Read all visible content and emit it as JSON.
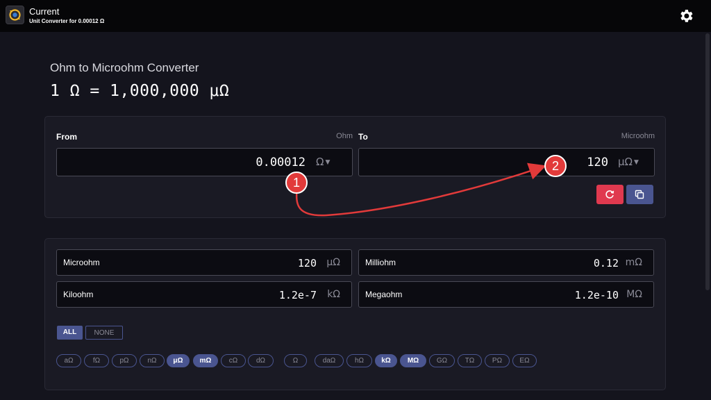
{
  "app": {
    "title": "Current",
    "subtitle": "Unit Converter for 0.00012 Ω"
  },
  "page": {
    "heading": "Ohm to Microohm Converter",
    "formula": "1 Ω = 1,000,000 μΩ"
  },
  "converter": {
    "from": {
      "label": "From",
      "unit_name": "Ohm",
      "value": "0.00012",
      "unit": "Ω"
    },
    "to": {
      "label": "To",
      "unit_name": "Microohm",
      "value": "120",
      "unit": "μΩ"
    }
  },
  "results": [
    {
      "name": "Microohm",
      "value": "120",
      "unit": "μΩ"
    },
    {
      "name": "Milliohm",
      "value": "0.12",
      "unit": "mΩ"
    },
    {
      "name": "Kiloohm",
      "value": "1.2e-7",
      "unit": "kΩ"
    },
    {
      "name": "Megaohm",
      "value": "1.2e-10",
      "unit": "MΩ"
    }
  ],
  "toggles": {
    "all": "ALL",
    "none": "NONE"
  },
  "chips": [
    {
      "label": "aΩ",
      "active": false
    },
    {
      "label": "fΩ",
      "active": false
    },
    {
      "label": "pΩ",
      "active": false
    },
    {
      "label": "nΩ",
      "active": false
    },
    {
      "label": "μΩ",
      "active": true
    },
    {
      "label": "mΩ",
      "active": true
    },
    {
      "label": "cΩ",
      "active": false
    },
    {
      "label": "dΩ",
      "active": false
    },
    {
      "label": "Ω",
      "active": false
    },
    {
      "label": "daΩ",
      "active": false
    },
    {
      "label": "hΩ",
      "active": false
    },
    {
      "label": "kΩ",
      "active": true
    },
    {
      "label": "MΩ",
      "active": true
    },
    {
      "label": "GΩ",
      "active": false
    },
    {
      "label": "TΩ",
      "active": false
    },
    {
      "label": "PΩ",
      "active": false
    },
    {
      "label": "EΩ",
      "active": false
    }
  ],
  "annotations": {
    "badge1": "1",
    "badge2": "2"
  },
  "colors": {
    "accent": "#4a5590",
    "reset_button": "#e0394f",
    "annotation": "#e23a3a",
    "background": "#14141d"
  }
}
